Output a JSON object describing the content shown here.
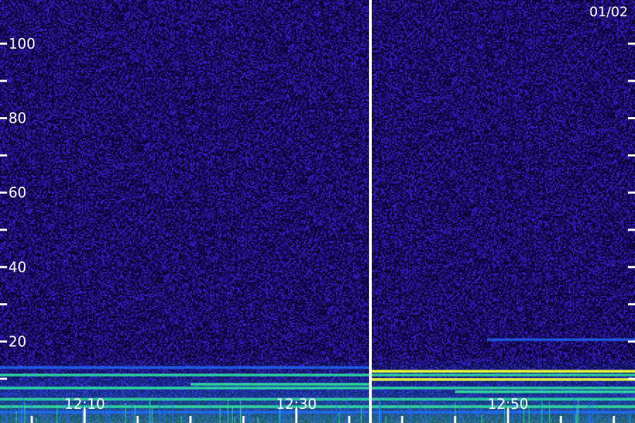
{
  "chart_data": {
    "type": "heatmap",
    "title": "",
    "xlabel": "",
    "ylabel": "",
    "date_label": "01/02",
    "x_tick_labels": [
      "12:10",
      "12:30",
      "12:50"
    ],
    "y_tick_labels": [
      "20",
      "40",
      "60",
      "80",
      "100"
    ],
    "ylim": [
      0,
      100
    ],
    "y_major_ticks": [
      20,
      40,
      60,
      80,
      100
    ],
    "y_minor_ticks": [
      10,
      30,
      50,
      70,
      90
    ],
    "xlim": [
      "12:02",
      "13:02"
    ],
    "x_major_ticks": [
      "12:10",
      "12:30",
      "12:50"
    ],
    "x_minor_ticks": [
      "12:05",
      "12:15",
      "12:20",
      "12:25",
      "12:35",
      "12:40",
      "12:45",
      "12:55",
      "13:00"
    ],
    "data_gap_at": "12:37",
    "grid": false,
    "colors": {
      "background": "#1b0b5a",
      "noise_low": "#0a0230",
      "noise_high": "#3a1cc8",
      "band_mid": "#1e6cff",
      "band_high": "#2fe0a0",
      "band_peak": "#e8ff40",
      "text": "#ffffff",
      "divider": "#ffffff"
    },
    "bands": [
      {
        "y": 20.5,
        "intensity": 0.45,
        "start": "12:48",
        "end": "13:02"
      },
      {
        "y": 13.0,
        "intensity": 0.55,
        "start": "12:02",
        "end": "12:37"
      },
      {
        "y": 12.0,
        "intensity": 0.95,
        "start": "12:37",
        "end": "13:02"
      },
      {
        "y": 11.0,
        "intensity": 0.7,
        "start": "12:02",
        "end": "13:02"
      },
      {
        "y": 9.8,
        "intensity": 0.9,
        "start": "12:37",
        "end": "13:02"
      },
      {
        "y": 8.5,
        "intensity": 0.8,
        "start": "12:20",
        "end": "12:37"
      },
      {
        "y": 7.5,
        "intensity": 0.75,
        "start": "12:02",
        "end": "13:02"
      },
      {
        "y": 6.5,
        "intensity": 0.85,
        "start": "12:45",
        "end": "13:02"
      },
      {
        "y": 4.5,
        "intensity": 0.7,
        "start": "12:02",
        "end": "13:02"
      },
      {
        "y": 2.5,
        "intensity": 0.8,
        "start": "12:02",
        "end": "13:02"
      },
      {
        "y": 1.0,
        "intensity": 0.6,
        "start": "12:02",
        "end": "13:02"
      }
    ]
  }
}
